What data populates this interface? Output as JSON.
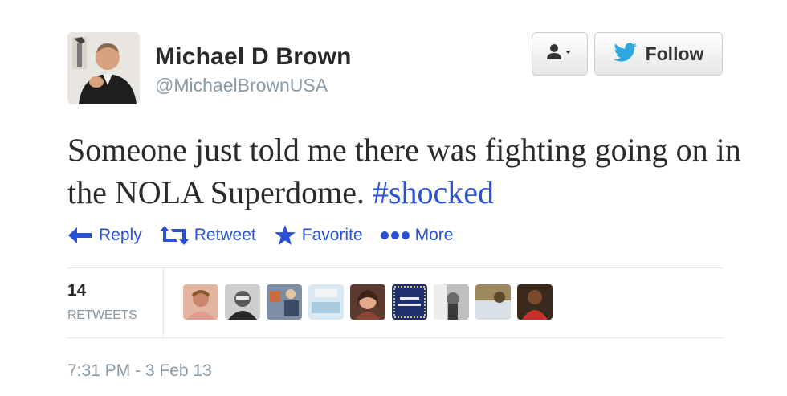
{
  "author": {
    "name": "Michael D Brown",
    "handle": "@MichaelBrownUSA"
  },
  "buttons": {
    "user_menu_icon": "user-dropdown-icon",
    "follow_label": "Follow"
  },
  "tweet": {
    "text": "Someone just told me there was fighting going on in the NOLA Superdome. ",
    "hashtag": "#shocked"
  },
  "actions": {
    "reply": "Reply",
    "retweet": "Retweet",
    "favorite": "Favorite",
    "more": "More"
  },
  "stats": {
    "retweets_count": "14",
    "retweets_label": "RETWEETS"
  },
  "timestamp": "7:31 PM - 3 Feb 13",
  "colors": {
    "link": "#2b52d4",
    "twitter_bird": "#2ea9df",
    "muted": "#8899a6"
  }
}
